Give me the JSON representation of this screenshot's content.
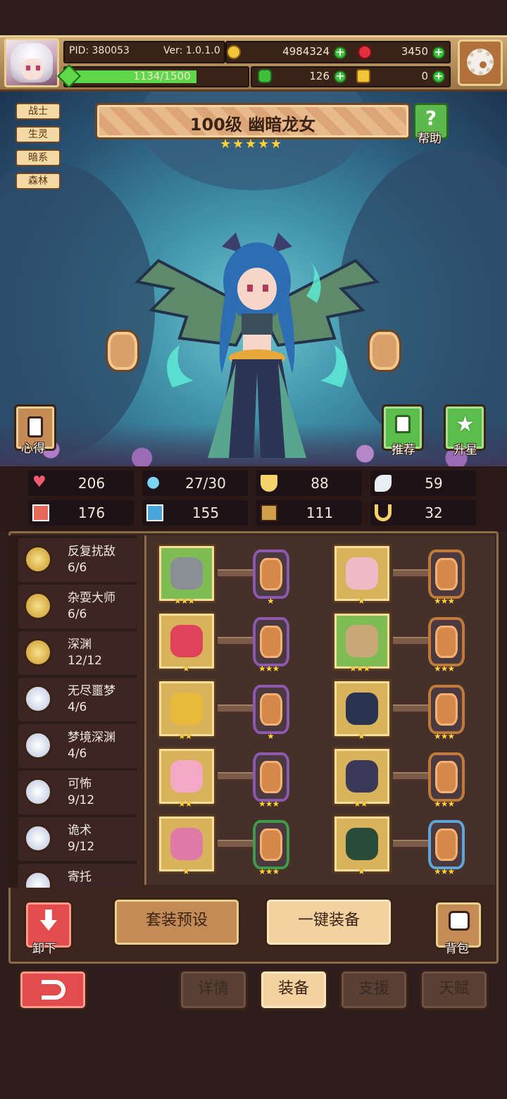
{
  "header": {
    "pid": "PID: 380053",
    "version": "Ver: 1.0.1.0",
    "gold": "4984324",
    "gems": "3450",
    "clover": "126",
    "keys": "0",
    "exp": "1134/1500",
    "exp_progress": 0.756
  },
  "hero": {
    "level_name": "100级 幽暗龙女",
    "stars": 5,
    "tags": [
      "战士",
      "生灵",
      "暗系",
      "森林"
    ]
  },
  "buttons": {
    "help": "帮助",
    "insight": "心得",
    "recommend": "推荐",
    "upgrade": "升星",
    "unequip": "卸下",
    "backpack": "背包",
    "preset": "套装预设",
    "auto_equip": "一键装备"
  },
  "stats": [
    {
      "icon": "heart-icon",
      "value": "206"
    },
    {
      "icon": "mana-drop-icon",
      "value": "27/30"
    },
    {
      "icon": "shield-icon",
      "value": "88"
    },
    {
      "icon": "wing-icon",
      "value": "59"
    },
    {
      "icon": "fist-icon",
      "value": "176"
    },
    {
      "icon": "book-icon",
      "value": "155"
    },
    {
      "icon": "scroll-icon",
      "value": "111"
    },
    {
      "icon": "horseshoe-icon",
      "value": "32"
    }
  ],
  "sets": [
    {
      "name": "反复扰敌",
      "count": "6/6",
      "tier": "gold"
    },
    {
      "name": "杂耍大师",
      "count": "6/6",
      "tier": "gold"
    },
    {
      "name": "深渊",
      "count": "12/12",
      "tier": "gold"
    },
    {
      "name": "无尽噩梦",
      "count": "4/6",
      "tier": "silver"
    },
    {
      "name": "梦境深渊",
      "count": "4/6",
      "tier": "silver"
    },
    {
      "name": "可怖",
      "count": "9/12",
      "tier": "silver"
    },
    {
      "name": "诡术",
      "count": "9/12",
      "tier": "silver"
    },
    {
      "name": "寄托",
      "count": "",
      "tier": "silver"
    }
  ],
  "equipment": [
    {
      "item": "spear",
      "item_stars": 3,
      "gem_color": "#8e58b0",
      "gem_stars": 1,
      "item_bg": "green"
    },
    {
      "item": "bear-hat",
      "item_stars": 1,
      "gem_color": "#c27a38",
      "gem_stars": 3,
      "item_bg": "gold"
    },
    {
      "item": "teddy-bear",
      "item_stars": 1,
      "gem_color": "#8e58b0",
      "gem_stars": 3,
      "item_bg": "gold"
    },
    {
      "item": "cloak",
      "item_stars": 3,
      "gem_color": "#c27a38",
      "gem_stars": 3,
      "item_bg": "green"
    },
    {
      "item": "necklace",
      "item_stars": 2,
      "gem_color": "#8e58b0",
      "gem_stars": 1,
      "item_bg": "gold"
    },
    {
      "item": "boots",
      "item_stars": 1,
      "gem_color": "#c27a38",
      "gem_stars": 3,
      "item_bg": "gold"
    },
    {
      "item": "heart-charm",
      "item_stars": 2,
      "gem_color": "#8e58b0",
      "gem_stars": 3,
      "item_bg": "gold"
    },
    {
      "item": "belt",
      "item_stars": 2,
      "gem_color": "#c27a38",
      "gem_stars": 3,
      "item_bg": "gold"
    },
    {
      "item": "winged-heart",
      "item_stars": 1,
      "gem_color": "#3f9a4a",
      "gem_stars": 3,
      "item_bg": "gold"
    },
    {
      "item": "armor-boots",
      "item_stars": 1,
      "gem_color": "#5fa6d8",
      "gem_stars": 3,
      "item_bg": "gold"
    }
  ],
  "tabs": [
    {
      "label": "详情",
      "active": false
    },
    {
      "label": "装备",
      "active": true
    },
    {
      "label": "支援",
      "active": false
    },
    {
      "label": "天赋",
      "active": false
    }
  ]
}
